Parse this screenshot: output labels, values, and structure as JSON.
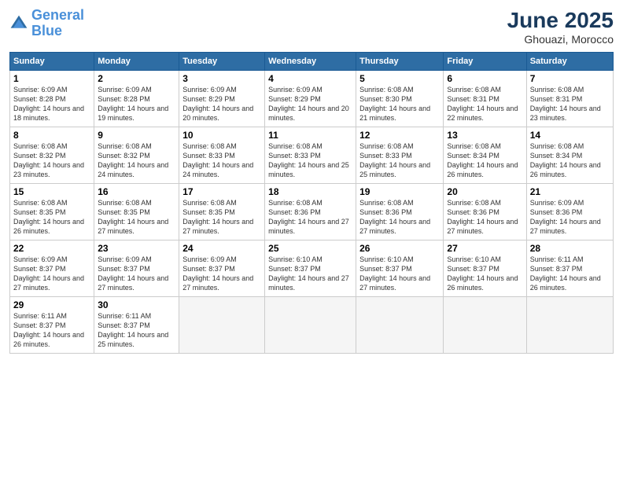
{
  "header": {
    "logo_line1": "General",
    "logo_line2": "Blue",
    "month": "June 2025",
    "location": "Ghouazi, Morocco"
  },
  "days_of_week": [
    "Sunday",
    "Monday",
    "Tuesday",
    "Wednesday",
    "Thursday",
    "Friday",
    "Saturday"
  ],
  "weeks": [
    [
      {
        "day": "1",
        "rise": "6:09 AM",
        "set": "8:28 PM",
        "hours": "14 hours and 18 minutes."
      },
      {
        "day": "2",
        "rise": "6:09 AM",
        "set": "8:28 PM",
        "hours": "14 hours and 19 minutes."
      },
      {
        "day": "3",
        "rise": "6:09 AM",
        "set": "8:29 PM",
        "hours": "14 hours and 20 minutes."
      },
      {
        "day": "4",
        "rise": "6:09 AM",
        "set": "8:29 PM",
        "hours": "14 hours and 20 minutes."
      },
      {
        "day": "5",
        "rise": "6:08 AM",
        "set": "8:30 PM",
        "hours": "14 hours and 21 minutes."
      },
      {
        "day": "6",
        "rise": "6:08 AM",
        "set": "8:31 PM",
        "hours": "14 hours and 22 minutes."
      },
      {
        "day": "7",
        "rise": "6:08 AM",
        "set": "8:31 PM",
        "hours": "14 hours and 23 minutes."
      }
    ],
    [
      {
        "day": "8",
        "rise": "6:08 AM",
        "set": "8:32 PM",
        "hours": "14 hours and 23 minutes."
      },
      {
        "day": "9",
        "rise": "6:08 AM",
        "set": "8:32 PM",
        "hours": "14 hours and 24 minutes."
      },
      {
        "day": "10",
        "rise": "6:08 AM",
        "set": "8:33 PM",
        "hours": "14 hours and 24 minutes."
      },
      {
        "day": "11",
        "rise": "6:08 AM",
        "set": "8:33 PM",
        "hours": "14 hours and 25 minutes."
      },
      {
        "day": "12",
        "rise": "6:08 AM",
        "set": "8:33 PM",
        "hours": "14 hours and 25 minutes."
      },
      {
        "day": "13",
        "rise": "6:08 AM",
        "set": "8:34 PM",
        "hours": "14 hours and 26 minutes."
      },
      {
        "day": "14",
        "rise": "6:08 AM",
        "set": "8:34 PM",
        "hours": "14 hours and 26 minutes."
      }
    ],
    [
      {
        "day": "15",
        "rise": "6:08 AM",
        "set": "8:35 PM",
        "hours": "14 hours and 26 minutes."
      },
      {
        "day": "16",
        "rise": "6:08 AM",
        "set": "8:35 PM",
        "hours": "14 hours and 27 minutes."
      },
      {
        "day": "17",
        "rise": "6:08 AM",
        "set": "8:35 PM",
        "hours": "14 hours and 27 minutes."
      },
      {
        "day": "18",
        "rise": "6:08 AM",
        "set": "8:36 PM",
        "hours": "14 hours and 27 minutes."
      },
      {
        "day": "19",
        "rise": "6:08 AM",
        "set": "8:36 PM",
        "hours": "14 hours and 27 minutes."
      },
      {
        "day": "20",
        "rise": "6:08 AM",
        "set": "8:36 PM",
        "hours": "14 hours and 27 minutes."
      },
      {
        "day": "21",
        "rise": "6:09 AM",
        "set": "8:36 PM",
        "hours": "14 hours and 27 minutes."
      }
    ],
    [
      {
        "day": "22",
        "rise": "6:09 AM",
        "set": "8:37 PM",
        "hours": "14 hours and 27 minutes."
      },
      {
        "day": "23",
        "rise": "6:09 AM",
        "set": "8:37 PM",
        "hours": "14 hours and 27 minutes."
      },
      {
        "day": "24",
        "rise": "6:09 AM",
        "set": "8:37 PM",
        "hours": "14 hours and 27 minutes."
      },
      {
        "day": "25",
        "rise": "6:10 AM",
        "set": "8:37 PM",
        "hours": "14 hours and 27 minutes."
      },
      {
        "day": "26",
        "rise": "6:10 AM",
        "set": "8:37 PM",
        "hours": "14 hours and 27 minutes."
      },
      {
        "day": "27",
        "rise": "6:10 AM",
        "set": "8:37 PM",
        "hours": "14 hours and 26 minutes."
      },
      {
        "day": "28",
        "rise": "6:11 AM",
        "set": "8:37 PM",
        "hours": "14 hours and 26 minutes."
      }
    ],
    [
      {
        "day": "29",
        "rise": "6:11 AM",
        "set": "8:37 PM",
        "hours": "14 hours and 26 minutes."
      },
      {
        "day": "30",
        "rise": "6:11 AM",
        "set": "8:37 PM",
        "hours": "14 hours and 25 minutes."
      },
      null,
      null,
      null,
      null,
      null
    ]
  ]
}
